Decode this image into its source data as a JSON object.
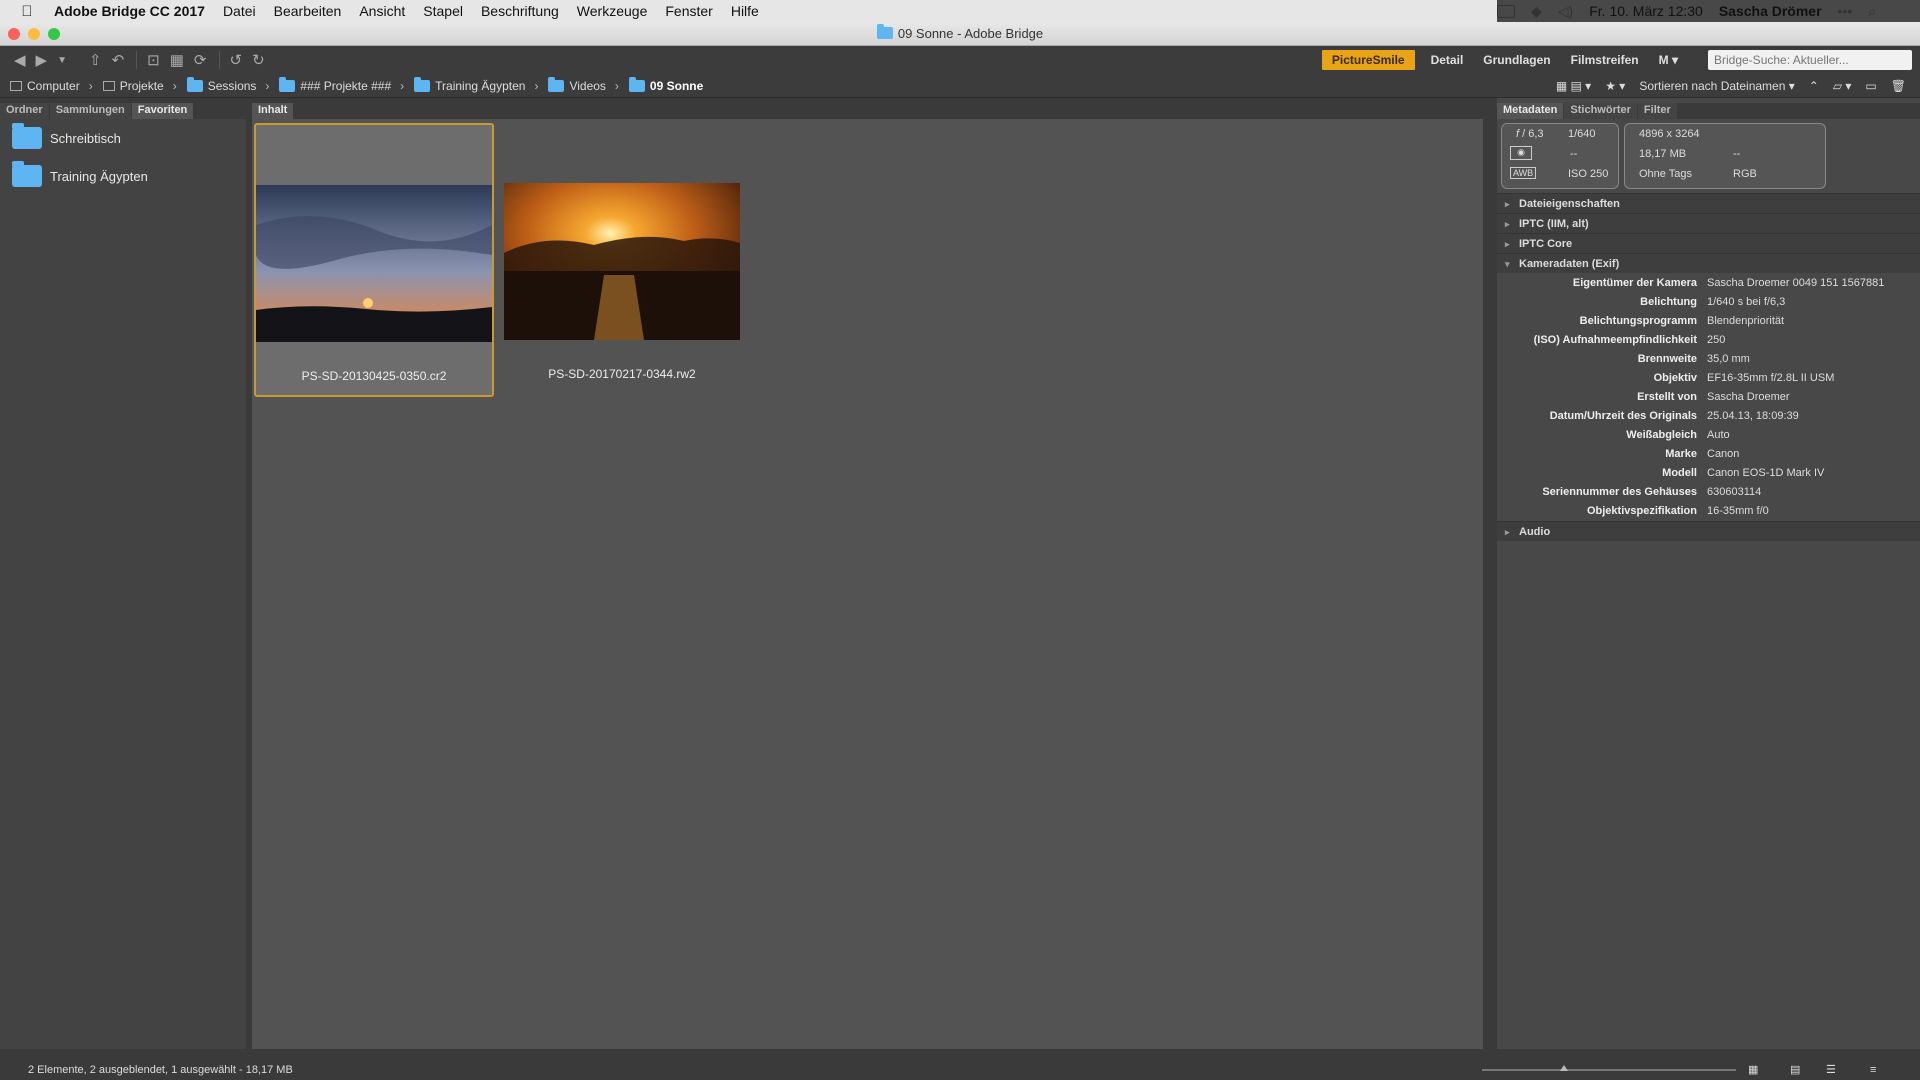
{
  "menubar": {
    "app": "Adobe Bridge CC 2017",
    "items": [
      "Datei",
      "Bearbeiten",
      "Ansicht",
      "Stapel",
      "Beschriftung",
      "Werkzeuge",
      "Fenster",
      "Hilfe"
    ],
    "clock": "Fr. 10. März 12:30",
    "user": "Sascha Drömer"
  },
  "window": {
    "title": "09 Sonne - Adobe Bridge"
  },
  "workspaces": {
    "active": "PictureSmile",
    "items": [
      "Detail",
      "Grundlagen",
      "Filmstreifen"
    ],
    "more": "M"
  },
  "search": {
    "placeholder": "Bridge-Suche: Aktueller..."
  },
  "path": [
    "Computer",
    "Projekte",
    "Sessions",
    "### Projekte ###",
    "Training Ägypten",
    "Videos",
    "09 Sonne"
  ],
  "sort": {
    "label": "Sortieren nach Dateinamen"
  },
  "left_panel": {
    "tabs": [
      "Ordner",
      "Sammlungen",
      "Favoriten"
    ],
    "favorites": [
      "Schreibtisch",
      "Training Ägypten"
    ]
  },
  "content": {
    "tab": "Inhalt",
    "items": [
      {
        "name": "PS-SD-20130425-0350.cr2",
        "selected": true
      },
      {
        "name": "PS-SD-20170217-0344.rw2",
        "selected": false
      }
    ]
  },
  "right_panel": {
    "tabs": [
      "Metadaten",
      "Stichwörter",
      "Filter"
    ],
    "quick": {
      "aperture": "6,3",
      "shutter": "1/640",
      "metering": "--",
      "iso": "250",
      "wb": "AWB",
      "dims": "4896 x 3264",
      "size": "18,17 MB",
      "dash": "--",
      "tags": "Ohne Tags",
      "mode": "RGB"
    },
    "sections": [
      "Dateieigenschaften",
      "IPTC (IIM, alt)",
      "IPTC Core",
      "Kameradaten (Exif)"
    ],
    "exif": [
      {
        "k": "Eigentümer der Kamera",
        "v": "Sascha Droemer 0049 151 1567881"
      },
      {
        "k": "Belichtung",
        "v": "1/640 s bei f/6,3"
      },
      {
        "k": "Belichtungsprogramm",
        "v": "Blendenpriorität"
      },
      {
        "k": "(ISO) Aufnahmeempfindlichkeit",
        "v": "250"
      },
      {
        "k": "Brennweite",
        "v": "35,0 mm"
      },
      {
        "k": "Objektiv",
        "v": "EF16-35mm f/2.8L II USM"
      },
      {
        "k": "Erstellt von",
        "v": "Sascha Droemer"
      },
      {
        "k": "Datum/Uhrzeit des Originals",
        "v": "25.04.13, 18:09:39"
      },
      {
        "k": "Weißabgleich",
        "v": "Auto"
      },
      {
        "k": "Marke",
        "v": "Canon"
      },
      {
        "k": "Modell",
        "v": "Canon EOS-1D Mark IV"
      },
      {
        "k": "Seriennummer des Gehäuses",
        "v": "630603114"
      },
      {
        "k": "Objektivspezifikation",
        "v": "16-35mm f/0"
      }
    ],
    "audio": "Audio"
  },
  "status": "2 Elemente, 2 ausgeblendet, 1 ausgewählt - 18,17 MB",
  "colors": {
    "accent": "#e8a317",
    "selection_border": "#c99a2e",
    "folder": "#5fb4f2"
  }
}
